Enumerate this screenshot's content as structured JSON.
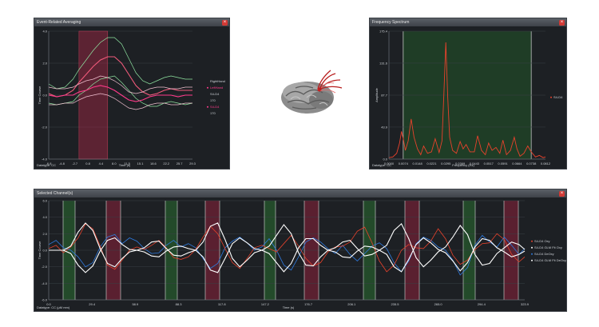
{
  "windows": {
    "erp": {
      "title": "Event-Related Averaging",
      "datatype": "Datatype: CC",
      "xlabel": "Time (s)",
      "ylabel": "Time Course",
      "close": "×",
      "legend": [
        "RightHand",
        "LeftHand",
        "S4-D4",
        "170",
        "S4-D4",
        "170"
      ]
    },
    "spectrum": {
      "title": "Frequency Spectrum",
      "datatype": "Datatype: CC",
      "xlabel": "Frequency (Hz)",
      "ylabel": "Amplitude",
      "close": "×",
      "legend": [
        "S4-D4"
      ]
    },
    "channels": {
      "title": "Selected Channel(s)",
      "datatype": "Datatype: CC (μM mm)",
      "xlabel": "Time (s)",
      "ylabel": "Time Course",
      "close": "×",
      "legend": [
        "S4-D4 Oxy",
        "S4-D4 GLM Fit Oxy",
        "S4-D4 DeOxy",
        "S4-D4 GLM Fit DeOxy"
      ]
    }
  },
  "colors": {
    "panel_bg": "#1d2024",
    "oxy": "#e8422c",
    "deoxy": "#2f7be0",
    "fit": "#ffffff",
    "rest_band": "#234a2a",
    "task_band": "#5a2030"
  },
  "icons": [
    "brain-3d-icon",
    "close-icon"
  ],
  "chart_data": [
    {
      "type": "line",
      "title": "Event-Related Averaging",
      "xlabel": "Time (s)",
      "ylabel": "Time Course",
      "xticks": [
        "-6.8",
        "-4.8",
        "-2.7",
        "0.8",
        "4.4",
        "8.0",
        "11.5",
        "15.1",
        "18.6",
        "22.2",
        "25.7",
        "29.3"
      ],
      "yticks": [
        "-4.0",
        "-2.0",
        "0.0",
        "2.0",
        "4.0"
      ],
      "xlim": [
        -6.8,
        29.3
      ],
      "ylim": [
        -4.0,
        4.0
      ],
      "highlight": [
        0.8,
        8.0
      ],
      "grid": true,
      "legend_position": "right",
      "x": [
        -6.8,
        -4.8,
        -2.7,
        -0.7,
        0.8,
        2.6,
        4.4,
        6.2,
        8.0,
        9.7,
        11.5,
        13.3,
        15.1,
        16.8,
        18.6,
        20.4,
        22.2,
        23.9,
        25.7,
        27.5,
        29.3
      ],
      "series": [
        {
          "name": "RightHand",
          "role": "upper",
          "color": "#8fe3a0",
          "values": [
            0.7,
            0.4,
            0.5,
            1.0,
            1.6,
            2.2,
            2.8,
            3.3,
            3.6,
            3.6,
            3.2,
            2.3,
            1.4,
            0.9,
            0.7,
            0.9,
            1.1,
            1.2,
            1.1,
            1.0,
            1.0
          ]
        },
        {
          "name": "RightHand",
          "role": "mean",
          "color": "#f05a7a",
          "values": [
            0.1,
            -0.1,
            0.0,
            0.3,
            0.8,
            1.3,
            1.8,
            2.2,
            2.4,
            2.4,
            2.0,
            1.3,
            0.6,
            0.2,
            0.0,
            0.1,
            0.3,
            0.4,
            0.3,
            0.3,
            0.3
          ]
        },
        {
          "name": "RightHand",
          "role": "lower",
          "color": "#8fe3a0",
          "values": [
            -0.5,
            -0.6,
            -0.5,
            -0.4,
            0.0,
            0.3,
            0.7,
            1.0,
            1.1,
            1.2,
            0.8,
            0.3,
            -0.2,
            -0.5,
            -0.7,
            -0.7,
            -0.5,
            -0.4,
            -0.5,
            -0.6,
            -0.5
          ]
        },
        {
          "name": "LeftHand",
          "role": "upper",
          "color": "#f0c0d0",
          "values": [
            0.5,
            0.4,
            0.4,
            0.5,
            0.7,
            0.9,
            1.0,
            1.2,
            1.1,
            0.9,
            0.6,
            0.2,
            0.1,
            0.2,
            0.4,
            0.5,
            0.5,
            0.4,
            0.4,
            0.5,
            0.5
          ]
        },
        {
          "name": "LeftHand",
          "role": "mean",
          "color": "#ff3a8a",
          "values": [
            0.0,
            -0.1,
            0.0,
            0.0,
            0.2,
            0.3,
            0.5,
            0.6,
            0.5,
            0.3,
            0.0,
            -0.3,
            -0.4,
            -0.3,
            -0.1,
            0.0,
            0.0,
            0.0,
            -0.1,
            0.0,
            0.0
          ]
        },
        {
          "name": "LeftHand",
          "role": "lower",
          "color": "#f0c0d0",
          "values": [
            -0.6,
            -0.6,
            -0.5,
            -0.5,
            -0.3,
            -0.1,
            0.0,
            0.1,
            0.0,
            -0.2,
            -0.5,
            -0.8,
            -0.9,
            -0.8,
            -0.6,
            -0.5,
            -0.5,
            -0.6,
            -0.6,
            -0.5,
            -0.5
          ]
        }
      ]
    },
    {
      "type": "line",
      "title": "Frequency Spectrum",
      "xlabel": "Frequency (Hz)",
      "ylabel": "Amplitude",
      "xticks": [
        "0.0000",
        "0.0074",
        "0.0148",
        "0.0221",
        "0.0295",
        "0.0369",
        "0.0443",
        "0.0517",
        "0.0591",
        "0.0664",
        "0.0738",
        "0.0812"
      ],
      "yticks": [
        "0.0",
        "43.9",
        "87.7",
        "131.6",
        "175.4"
      ],
      "xlim": [
        0.0,
        0.0812
      ],
      "ylim": [
        0.0,
        175.4
      ],
      "band": [
        0.0074,
        0.0738
      ],
      "legend_position": "right",
      "series": [
        {
          "name": "S4-D4",
          "color": "#e8422c",
          "x": [
            0.0,
            0.002,
            0.004,
            0.0055,
            0.0065,
            0.0074,
            0.0085,
            0.01,
            0.0115,
            0.013,
            0.0148,
            0.0165,
            0.018,
            0.02,
            0.0221,
            0.024,
            0.026,
            0.0275,
            0.0285,
            0.0295,
            0.0305,
            0.0315,
            0.033,
            0.035,
            0.0369,
            0.0385,
            0.04,
            0.042,
            0.0443,
            0.046,
            0.048,
            0.05,
            0.0517,
            0.0535,
            0.0555,
            0.0575,
            0.0591,
            0.061,
            0.063,
            0.065,
            0.0664,
            0.068,
            0.07,
            0.072,
            0.0738,
            0.076,
            0.078,
            0.08,
            0.0812
          ],
          "values": [
            2,
            3,
            8,
            22,
            38,
            28,
            12,
            25,
            55,
            30,
            14,
            6,
            18,
            8,
            10,
            28,
            9,
            25,
            90,
            160,
            85,
            30,
            12,
            8,
            24,
            14,
            20,
            10,
            10,
            32,
            12,
            6,
            22,
            12,
            16,
            8,
            26,
            6,
            12,
            30,
            14,
            4,
            8,
            18,
            10,
            3,
            5,
            2,
            3
          ]
        }
      ]
    },
    {
      "type": "line",
      "title": "Selected Channel(s)",
      "xlabel": "Time (s)",
      "ylabel": "Time Course",
      "xticks": [
        "0.0",
        "29.4",
        "58.9",
        "88.3",
        "117.8",
        "147.2",
        "176.7",
        "206.1",
        "235.5",
        "265.0",
        "294.4",
        "323.9"
      ],
      "yticks": [
        "-6.0",
        "-4.0",
        "-2.0",
        "0.0",
        "2.0",
        "4.0",
        "6.0"
      ],
      "xlim": [
        0.0,
        323.9
      ],
      "ylim": [
        -6.0,
        6.0
      ],
      "legend_position": "right",
      "rest_bands": [
        [
          18,
          33
        ],
        [
          146,
          161
        ],
        [
          270,
          284
        ],
        [
          394,
          409
        ],
        [
          519,
          534
        ]
      ],
      "task_bands": [
        [
          72,
          90
        ],
        [
          196,
          214
        ],
        [
          320,
          338
        ],
        [
          446,
          464
        ],
        [
          570,
          588
        ]
      ],
      "vlines": [
        18,
        33,
        72,
        90,
        146,
        161,
        196,
        214,
        270,
        284,
        320,
        338,
        394,
        409,
        446,
        464,
        519,
        534,
        570,
        588
      ],
      "series": [
        {
          "name": "S4-D4 Oxy",
          "color": "#e8422c",
          "x": [
            0,
            5,
            10,
            15,
            20,
            25,
            30,
            35,
            40,
            45,
            50,
            55,
            60,
            65,
            70,
            75,
            80,
            85,
            90,
            95,
            100,
            105,
            110,
            115,
            120,
            125,
            130,
            135,
            140,
            145,
            150,
            155,
            160,
            165,
            170,
            175,
            180,
            185,
            190,
            195,
            200,
            205,
            210,
            215,
            220,
            225,
            230,
            235,
            240,
            245,
            250,
            255,
            260,
            265,
            270,
            275,
            280,
            285,
            290,
            295,
            300,
            305,
            310,
            315,
            320,
            323.9
          ],
          "values": [
            0.2,
            0.6,
            -0.3,
            0.4,
            1.5,
            3.2,
            2.6,
            0.5,
            -1.8,
            -2.3,
            -1.2,
            0.0,
            0.4,
            0.1,
            0.6,
            1.2,
            0.3,
            -0.9,
            -1.1,
            -0.8,
            0.1,
            1.6,
            2.9,
            2.0,
            0.2,
            -1.5,
            -2.2,
            -1.0,
            0.3,
            0.6,
            0.2,
            -0.2,
            0.8,
            1.8,
            0.5,
            -1.0,
            -1.9,
            -1.5,
            -0.2,
            0.4,
            0.5,
            1.0,
            2.3,
            2.8,
            0.9,
            -1.3,
            -2.6,
            -1.8,
            0.0,
            0.7,
            0.3,
            0.2,
            1.1,
            2.6,
            1.4,
            -0.6,
            -1.7,
            -1.2,
            0.1,
            0.8,
            0.9,
            2.0,
            1.3,
            -0.5,
            -1.4,
            -0.8
          ]
        },
        {
          "name": "S4-D4 GLM Fit Oxy",
          "color": "#ffffff",
          "x": [
            0,
            5,
            10,
            15,
            20,
            25,
            30,
            35,
            40,
            45,
            50,
            55,
            60,
            65,
            70,
            75,
            80,
            85,
            90,
            95,
            100,
            105,
            110,
            115,
            120,
            125,
            130,
            135,
            140,
            145,
            150,
            155,
            160,
            165,
            170,
            175,
            180,
            185,
            190,
            195,
            200,
            205,
            210,
            215,
            220,
            225,
            230,
            235,
            240,
            245,
            250,
            255,
            260,
            265,
            270,
            275,
            280,
            285,
            290,
            295,
            300,
            305,
            310,
            315,
            320,
            323.9
          ],
          "values": [
            0.0,
            0.0,
            0.0,
            0.5,
            2.2,
            3.3,
            2.4,
            0.2,
            -1.6,
            -2.0,
            -1.0,
            -0.2,
            0.0,
            0.3,
            1.0,
            1.1,
            0.2,
            -0.6,
            -0.7,
            -0.3,
            0.0,
            1.0,
            2.9,
            3.3,
            1.3,
            -1.0,
            -2.0,
            -1.2,
            -0.3,
            0.0,
            0.5,
            1.8,
            3.1,
            2.0,
            -0.3,
            -1.8,
            -1.9,
            -0.8,
            0.0,
            0.3,
            1.0,
            1.2,
            0.2,
            -0.7,
            -0.5,
            0.0,
            0.6,
            2.4,
            3.2,
            1.4,
            -0.9,
            -2.0,
            -1.2,
            -0.2,
            0.4,
            1.6,
            3.0,
            1.9,
            -0.5,
            -1.8,
            -1.6,
            -0.4,
            0.3,
            1.0,
            0.7,
            0.1
          ]
        },
        {
          "name": "S4-D4 DeOxy",
          "color": "#2f7be0",
          "x": [
            0,
            5,
            10,
            15,
            20,
            25,
            30,
            35,
            40,
            45,
            50,
            55,
            60,
            65,
            70,
            75,
            80,
            85,
            90,
            95,
            100,
            105,
            110,
            115,
            120,
            125,
            130,
            135,
            140,
            145,
            150,
            155,
            160,
            165,
            170,
            175,
            180,
            185,
            190,
            195,
            200,
            205,
            210,
            215,
            220,
            225,
            230,
            235,
            240,
            245,
            250,
            255,
            260,
            265,
            270,
            275,
            280,
            285,
            290,
            295,
            300,
            305,
            310,
            315,
            320,
            323.9
          ],
          "values": [
            0.7,
            1.2,
            0.3,
            0.0,
            -0.8,
            -2.0,
            -1.5,
            0.4,
            1.6,
            1.9,
            0.8,
            1.5,
            1.1,
            0.2,
            -0.4,
            -0.3,
            0.6,
            1.2,
            0.4,
            0.8,
            0.3,
            -1.0,
            -2.2,
            -1.6,
            0.3,
            1.1,
            1.6,
            0.9,
            0.0,
            0.4,
            1.4,
            0.0,
            -1.8,
            -2.4,
            -0.8,
            1.0,
            1.5,
            1.0,
            0.2,
            -0.4,
            0.6,
            -0.5,
            -1.3,
            -0.4,
            0.5,
            0.9,
            0.2,
            -1.5,
            -2.6,
            -1.3,
            0.8,
            1.6,
            1.2,
            0.4,
            0.0,
            -1.2,
            -3.0,
            -2.1,
            0.6,
            1.8,
            1.0,
            0.4,
            1.6,
            0.6,
            -0.5,
            0.2
          ]
        },
        {
          "name": "S4-D4 GLM Fit DeOxy",
          "color": "#ffffff",
          "x": [
            0,
            5,
            10,
            15,
            20,
            25,
            30,
            35,
            40,
            45,
            50,
            55,
            60,
            65,
            70,
            75,
            80,
            85,
            90,
            95,
            100,
            105,
            110,
            115,
            120,
            125,
            130,
            135,
            140,
            145,
            150,
            155,
            160,
            165,
            170,
            175,
            180,
            185,
            190,
            195,
            200,
            205,
            210,
            215,
            220,
            225,
            230,
            235,
            240,
            245,
            250,
            255,
            260,
            265,
            270,
            275,
            280,
            285,
            290,
            295,
            300,
            305,
            310,
            315,
            320,
            323.9
          ],
          "values": [
            0.0,
            0.0,
            0.0,
            -0.4,
            -1.8,
            -2.7,
            -1.9,
            -0.1,
            1.2,
            1.5,
            0.7,
            0.1,
            0.0,
            -0.2,
            -0.7,
            -0.8,
            -0.1,
            0.4,
            0.5,
            0.2,
            0.0,
            -0.8,
            -2.4,
            -2.7,
            -1.0,
            0.8,
            1.5,
            0.9,
            0.2,
            0.0,
            -0.4,
            -1.5,
            -2.6,
            -1.6,
            0.3,
            1.4,
            1.4,
            0.6,
            0.0,
            -0.2,
            -0.8,
            -0.9,
            -0.1,
            0.5,
            0.4,
            0.0,
            -0.5,
            -2.0,
            -2.6,
            -1.1,
            0.7,
            1.5,
            0.9,
            0.1,
            -0.3,
            -1.3,
            -2.5,
            -1.5,
            0.4,
            1.4,
            1.2,
            0.3,
            -0.2,
            -0.8,
            -0.5,
            -0.1
          ]
        }
      ]
    }
  ]
}
